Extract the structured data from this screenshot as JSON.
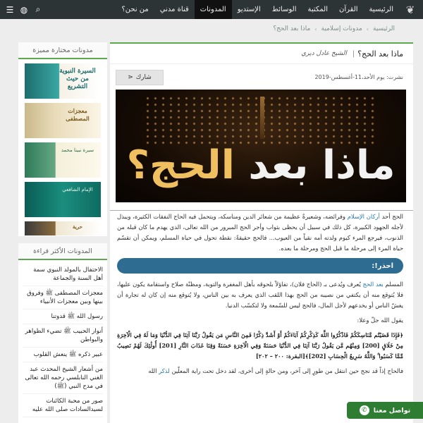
{
  "nav": {
    "items": [
      {
        "label": "الرئيسية",
        "active": false
      },
      {
        "label": "القرآن",
        "active": false
      },
      {
        "label": "المكتبة",
        "active": false
      },
      {
        "label": "الوسائط",
        "active": false
      },
      {
        "label": "الإستديو",
        "active": false
      },
      {
        "label": "المدونات",
        "active": true
      },
      {
        "label": "قناة مدني",
        "active": false
      },
      {
        "label": "من نحن؟",
        "active": false
      }
    ],
    "icons": [
      "search-icon",
      "globe-icon",
      "menu-icon"
    ]
  },
  "breadcrumb": [
    "الرئيسية",
    "مدونات إسلامية",
    "ماذا بعد الحج؟"
  ],
  "post": {
    "title": "ماذا بعد الحج؟",
    "author": "الشيخ عادل ديري",
    "published": "نشرت: يوم الأحد،11-أغسطس-2019",
    "share_label": "شارك",
    "hero_text_a": "ماذا بعد",
    "hero_text_b": "الحج؟",
    "p1_before": "الحج أحد",
    "p1_link": "أركان الإسلام",
    "p1_after": " وفرائضه، وشعيرةٌ عظيمة من شعائر الدين ومناسكه، ويتحمل فيه الحاج النفقات الكثيرة، ويبذل لأجله الجهود الكبيرة، كل ذلك في سبيل أن يحظى بثواب وأجر الحج المبرور من الله تعالى، الذي يهدم ما كان قبله من الذنوب، فيرجع المرء كيوم ولدته أمه نقياً من العيوب... فالحج حقيقةً: نقطة تحول في حياة المسلم، ويمكن أن تقسّم حياة المرء إلى مرحلة ما قبل الحج ومرحلة ما بعده.",
    "callout": "احذر!:",
    "p2_before": "المسلم",
    "p2_link": "بعد الحج",
    "p2_after": " يُعرف ويُدعى بـ (الحاج فلان)، تفاؤلاً بلحوقه بأهل المغفرة والتوبة، ومظنّة صلاح واستقامة يكون عليها، فلا يُتوقع منه أن يكتفي من نصيبه من الحج بهذا اللقب الذي يعرف به بين الناس، ولا يُتوقع منه إن كان له تجارة أن يغشّ الناس أو يخدعهم لأجل المال، فالحج ليس للسّمعة ولا لتكسّب الدنيا.",
    "p3": "يقول الله جلّ وعلا:",
    "quran": "﴿فَإِذَا قَضَيْتُم مَّنَاسِكَكُمْ فَاذْكُرُوا اللَّهَ كَذِكْرِكُمْ آبَاءَكُمْ أَوْ أَشَدَّ ذِكْرًا فَمِنَ النَّاسِ مَن يَقُولُ رَبَّنَا آتِنَا فِي الدُّنْيَا وَمَا لَهُ فِي الْآخِرَةِ مِنْ خَلَاقٍ [200] وَمِنْهُم مَّن يَقُولُ رَبَّنَا آتِنَا فِي الدُّنْيَا حَسَنَةً وَفِي الْآخِرَةِ حَسَنَةً وَقِنَا عَذَابَ النَّارِ [201] أُولَٰئِكَ لَهُمْ نَصِيبٌ مِّمَّا كَسَبُوا ۚ وَاللَّهُ سَرِيعُ الْحِسَابِ [202]﴾[البقرة: ٢٠٠ – ٢٠٢]",
    "p4_before": "فالحاج إذاً قد نجح حين انتقل من طورٍ إلى آخر، ومن حالةٍ إلى أخرى، لقد دخل تحت راية المعلّين",
    "p4_link": "لذكر",
    "p4_after": " الله"
  },
  "sidebar": {
    "featured_title": "مدونات مختارة مميزة",
    "thumbs": [
      {
        "text": "السيرة النبوية من حيث التشريع"
      },
      {
        "text": "معجزات المصطفى"
      },
      {
        "text": "سيرة نبينا محمد"
      },
      {
        "text": "الإمام الشافعي"
      },
      {
        "text": "حرية"
      }
    ],
    "most_read_title": "المدونات الأكثر قراءة",
    "most_read": [
      "الاحتفال بالمولد النبوي سمة أهل السنة والجماعة",
      "معجزات المصطفى ﷺ وفروق بينها وبين معجزات الأنبياء",
      "رسول الله ﷺ قدوتنا",
      "أنوار الحبيب ﷺ تضيء الظواهر والبواطن",
      "عبير ذكره ﷺ ينعش القلوب",
      "من أشعار الشيخ المحدث عبد الغني النابلسي رحمه الله تعالى في مدح النبي (ﷺ)",
      "صور من محبة الكائنات لسيدالسادات صلى الله عليه"
    ]
  },
  "contact": {
    "label": "تواصل معنا"
  }
}
